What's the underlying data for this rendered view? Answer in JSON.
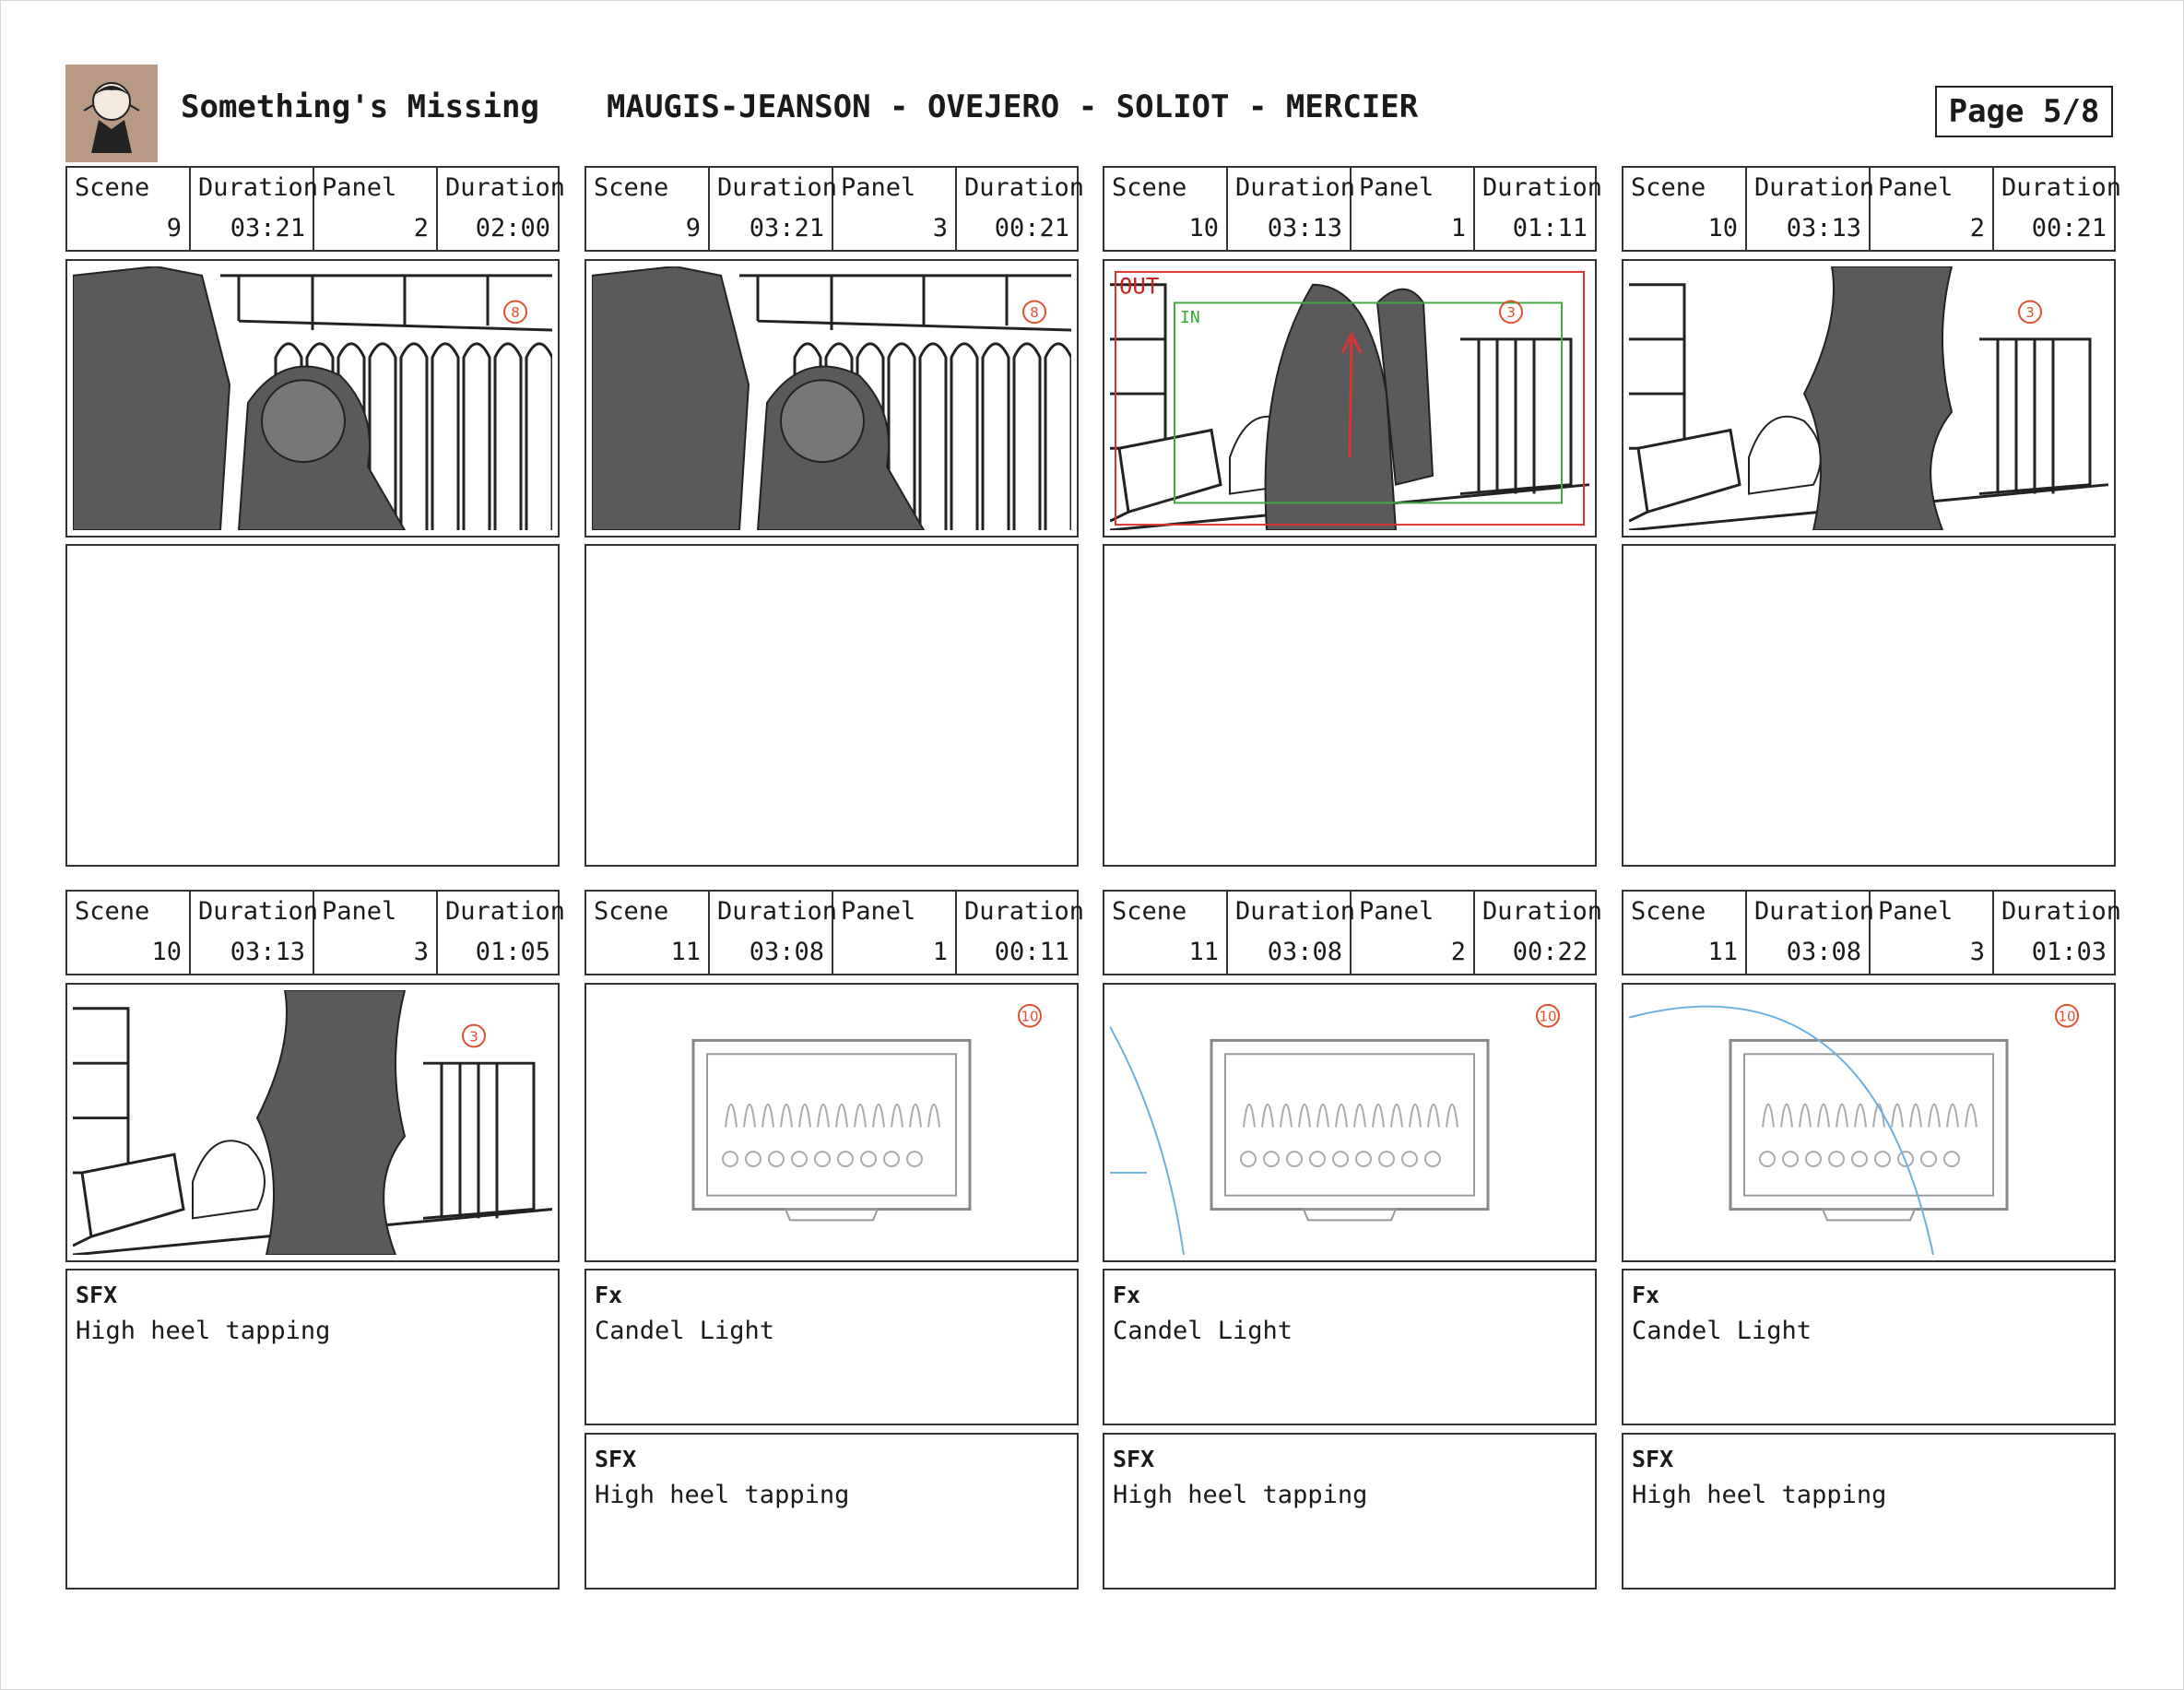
{
  "header": {
    "title": "Something's Missing",
    "authors": "MAUGIS-JEANSON - OVEJERO - SOLIOT - MERCIER",
    "page": "Page 5/8"
  },
  "labels": {
    "scene": "Scene",
    "duration": "Duration",
    "panel": "Panel"
  },
  "panels": [
    {
      "scene": "9",
      "scene_duration": "03:21",
      "panel": "2",
      "panel_duration": "02:00",
      "marker": "8",
      "notes": []
    },
    {
      "scene": "9",
      "scene_duration": "03:21",
      "panel": "3",
      "panel_duration": "00:21",
      "marker": "8",
      "notes": []
    },
    {
      "scene": "10",
      "scene_duration": "03:13",
      "panel": "1",
      "panel_duration": "01:11",
      "marker": "3",
      "frame_labels": [
        "OUT",
        "IN"
      ],
      "notes": []
    },
    {
      "scene": "10",
      "scene_duration": "03:13",
      "panel": "2",
      "panel_duration": "00:21",
      "marker": "3",
      "notes": []
    },
    {
      "scene": "10",
      "scene_duration": "03:13",
      "panel": "3",
      "panel_duration": "01:05",
      "marker": "3",
      "notes": [
        {
          "title": "SFX",
          "body": "High heel tapping"
        }
      ]
    },
    {
      "scene": "11",
      "scene_duration": "03:08",
      "panel": "1",
      "panel_duration": "00:11",
      "marker": "10",
      "notes": [
        {
          "title": "Fx",
          "body": "Candel Light"
        },
        {
          "title": "SFX",
          "body": "High heel tapping"
        }
      ]
    },
    {
      "scene": "11",
      "scene_duration": "03:08",
      "panel": "2",
      "panel_duration": "00:22",
      "marker": "10",
      "notes": [
        {
          "title": "Fx",
          "body": "Candel Light"
        },
        {
          "title": "SFX",
          "body": "High heel tapping"
        }
      ]
    },
    {
      "scene": "11",
      "scene_duration": "03:08",
      "panel": "3",
      "panel_duration": "01:03",
      "marker": "10",
      "notes": [
        {
          "title": "Fx",
          "body": "Candel Light"
        },
        {
          "title": "SFX",
          "body": "High heel tapping"
        }
      ]
    }
  ]
}
